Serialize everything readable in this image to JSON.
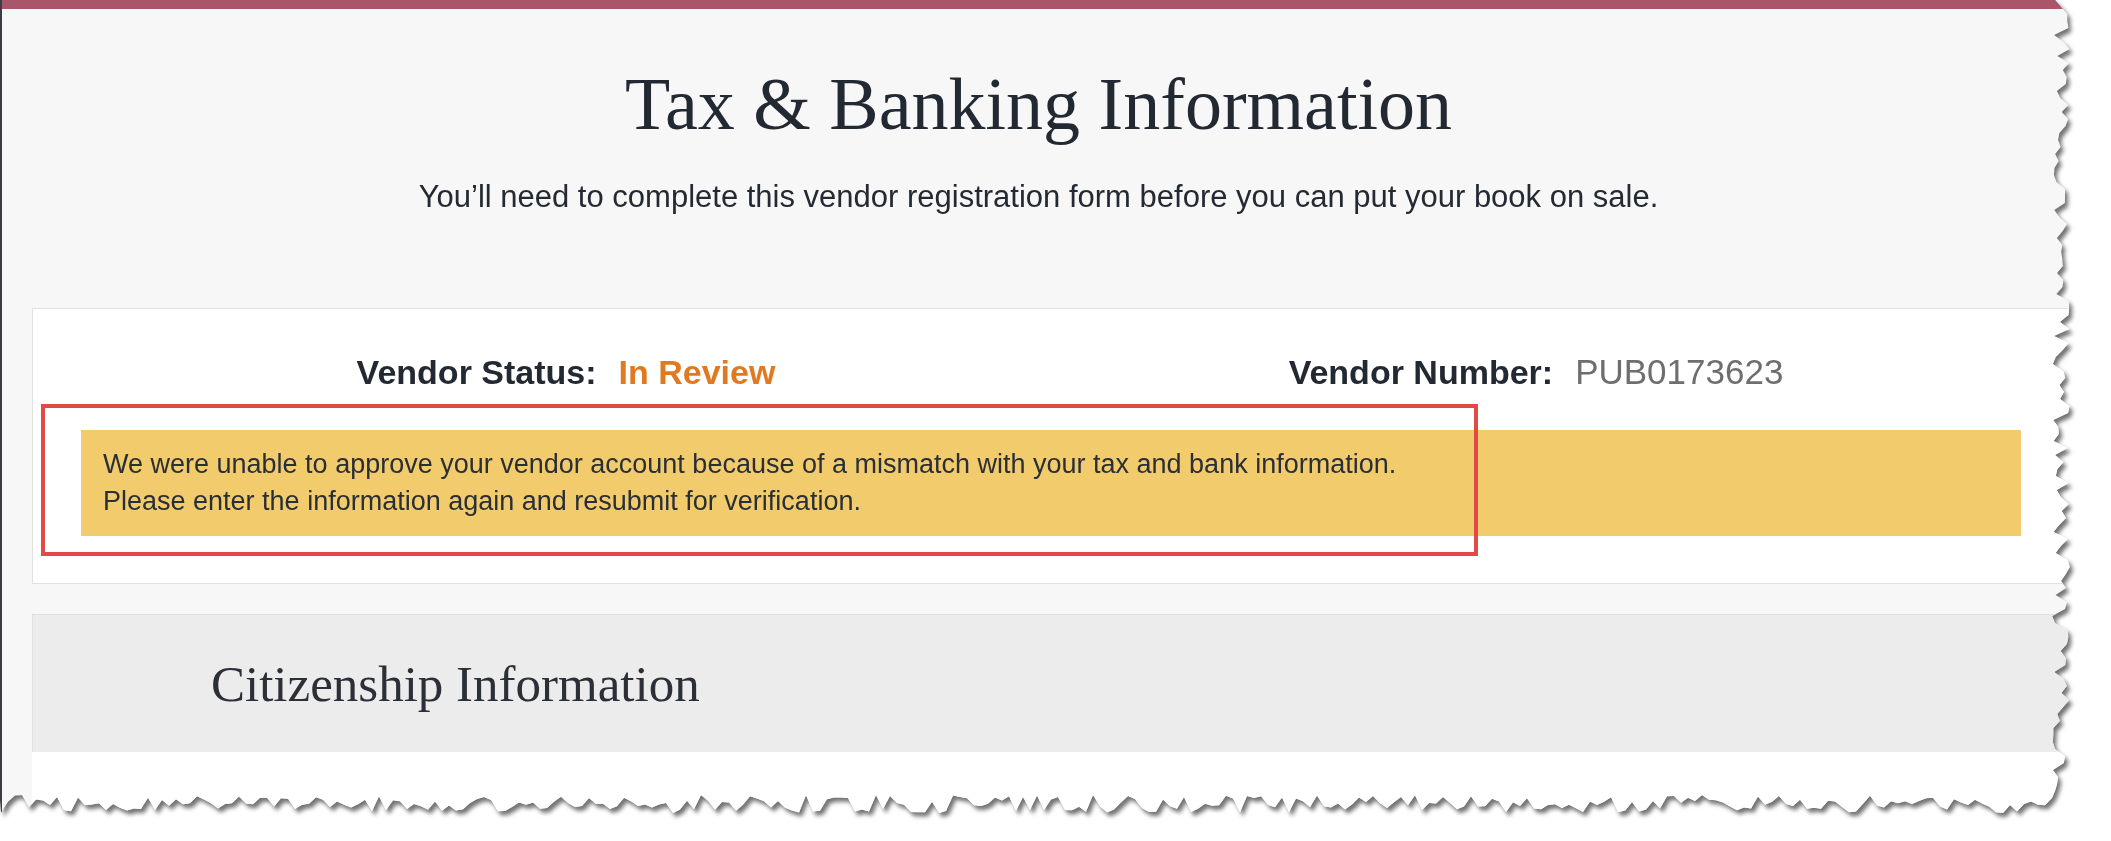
{
  "header": {
    "title": "Tax & Banking Information",
    "subtitle": "You’ll need to complete this vendor registration form before you can put your book on sale."
  },
  "vendor": {
    "fields": [
      {
        "kind": "status",
        "label": "Vendor Status:",
        "value": "In Review"
      },
      {
        "kind": "number",
        "label": "Vendor Number:",
        "value": "PUB0173623"
      }
    ]
  },
  "notice": {
    "highlighted": true,
    "lines": [
      "We were unable to approve your vendor account because of a mismatch with your tax and bank information.",
      "Please enter the information again and resubmit for verification."
    ]
  },
  "sections": [
    {
      "title": "Citizenship Information"
    }
  ]
}
